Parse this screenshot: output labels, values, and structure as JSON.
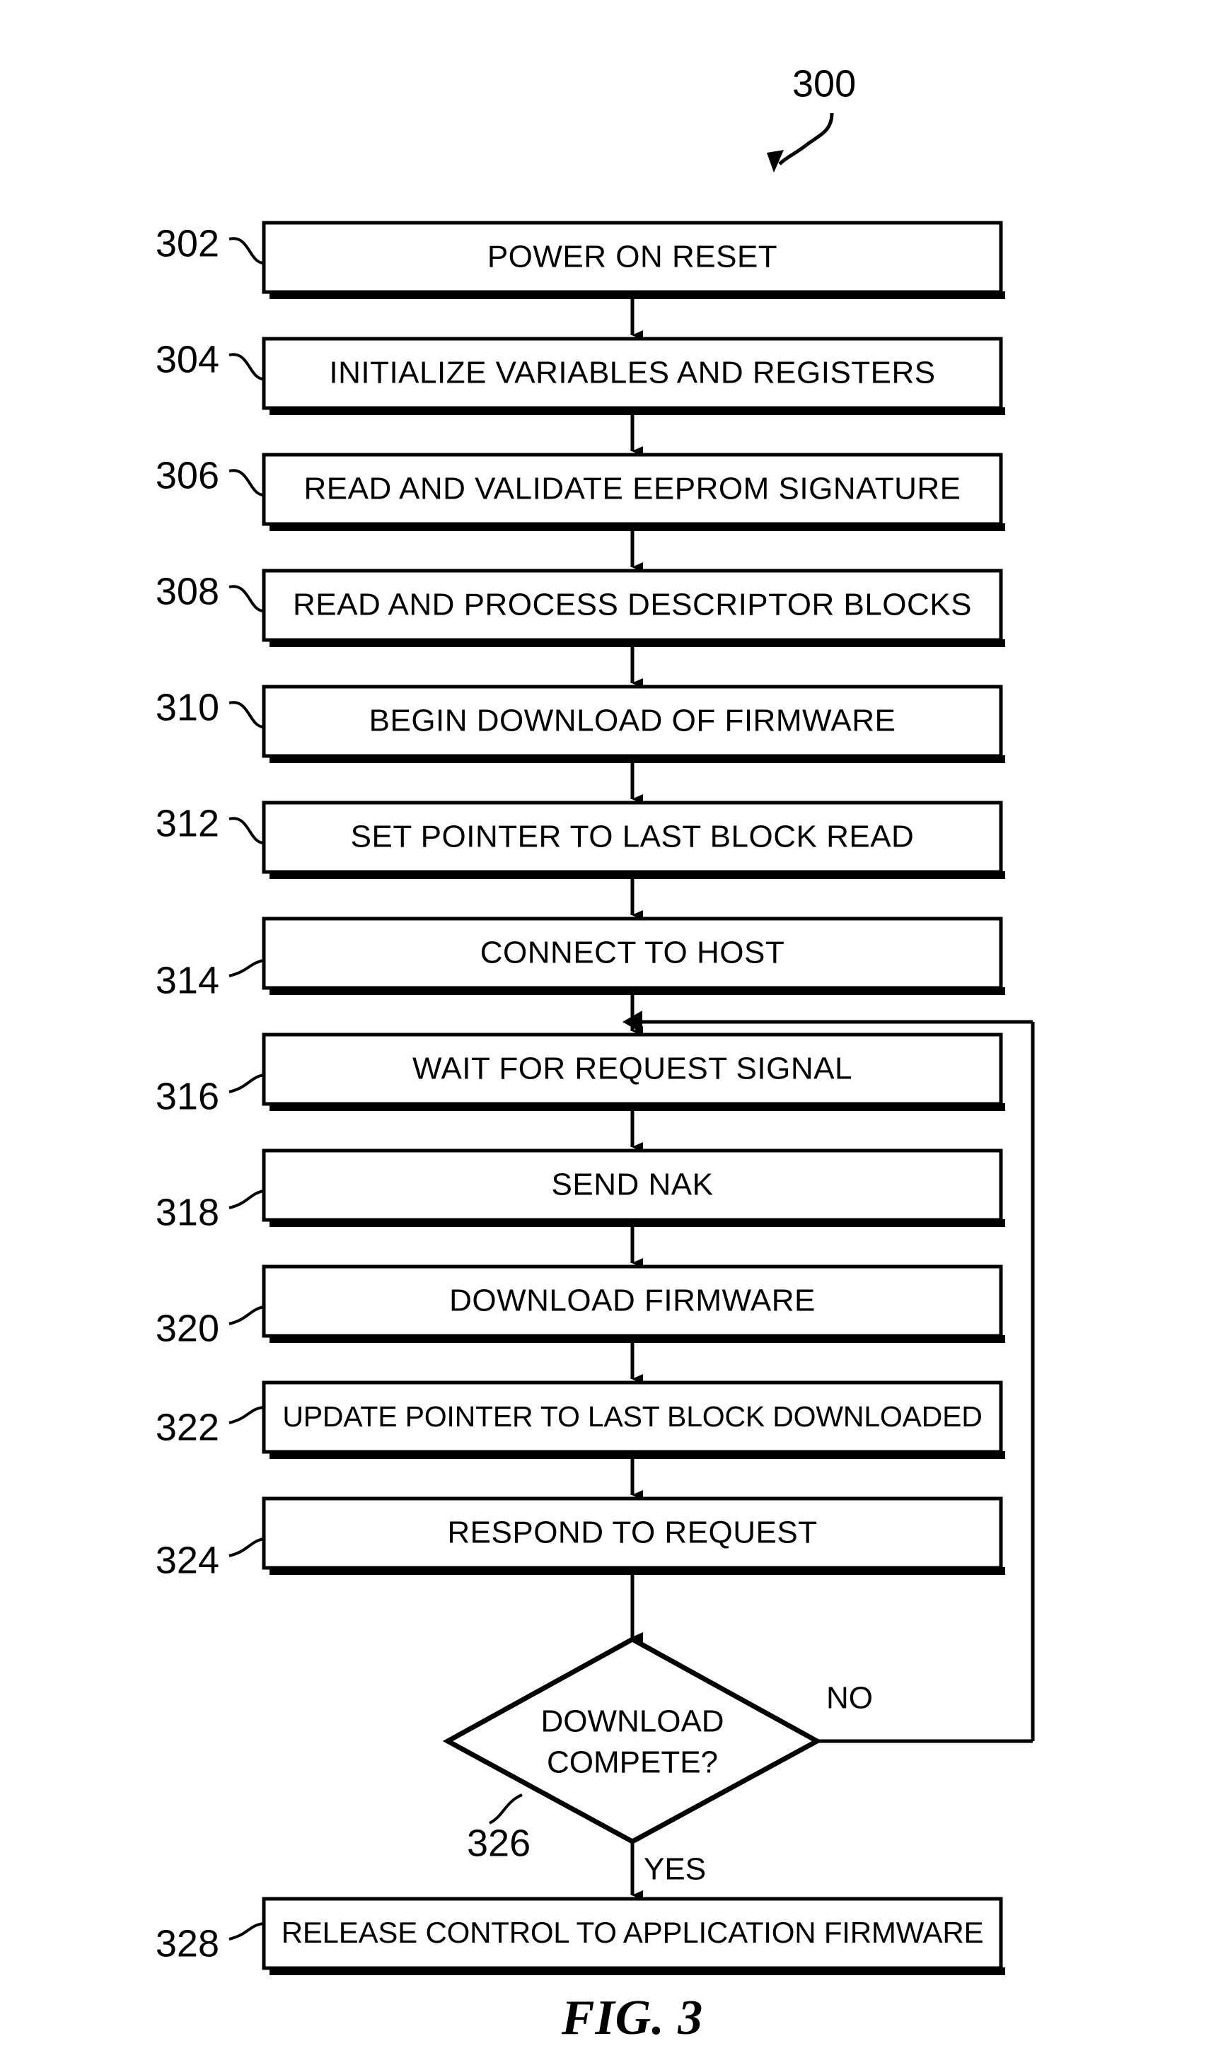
{
  "figure": {
    "caption": "FIG. 3",
    "diagram_ref": "300"
  },
  "nodes": [
    {
      "ref": "302",
      "label": "POWER ON RESET",
      "shape": "process"
    },
    {
      "ref": "304",
      "label": "INITIALIZE VARIABLES AND REGISTERS",
      "shape": "process"
    },
    {
      "ref": "306",
      "label": "READ AND VALIDATE EEPROM SIGNATURE",
      "shape": "process"
    },
    {
      "ref": "308",
      "label": "READ AND PROCESS DESCRIPTOR BLOCKS",
      "shape": "process"
    },
    {
      "ref": "310",
      "label": "BEGIN DOWNLOAD OF FIRMWARE",
      "shape": "process"
    },
    {
      "ref": "312",
      "label": "SET POINTER TO LAST BLOCK READ",
      "shape": "process"
    },
    {
      "ref": "314",
      "label": "CONNECT TO HOST",
      "shape": "process"
    },
    {
      "ref": "316",
      "label": "WAIT FOR REQUEST SIGNAL",
      "shape": "process"
    },
    {
      "ref": "318",
      "label": "SEND NAK",
      "shape": "process"
    },
    {
      "ref": "320",
      "label": "DOWNLOAD FIRMWARE",
      "shape": "process"
    },
    {
      "ref": "322",
      "label": "UPDATE POINTER TO LAST BLOCK DOWNLOADED",
      "shape": "process"
    },
    {
      "ref": "324",
      "label": "RESPOND TO REQUEST",
      "shape": "process"
    },
    {
      "ref": "326",
      "label_line1": "DOWNLOAD",
      "label_line2": "COMPETE?",
      "shape": "decision"
    },
    {
      "ref": "328",
      "label": "RELEASE CONTROL TO APPLICATION FIRMWARE",
      "shape": "process"
    }
  ],
  "edge_labels": {
    "no": "NO",
    "yes": "YES"
  },
  "colors": {
    "ink": "#000000",
    "paper": "#ffffff"
  }
}
